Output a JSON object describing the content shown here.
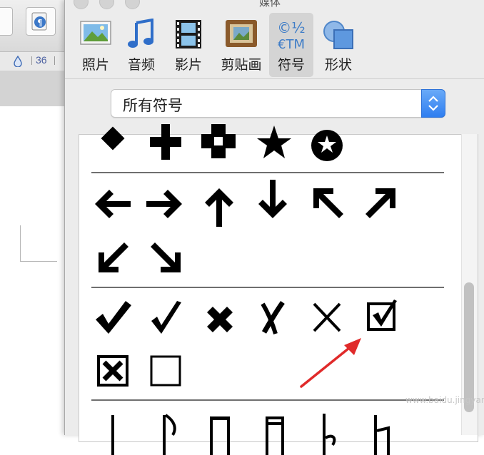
{
  "document_window": {
    "ruler_value": "36",
    "paragraph_icon": "paragraph-mark-icon",
    "drop_icon": "drop-icon"
  },
  "media_browser": {
    "title": "媒体",
    "tabs": [
      {
        "label": "照片",
        "icon": "photo-icon"
      },
      {
        "label": "音频",
        "icon": "music-note-icon"
      },
      {
        "label": "影片",
        "icon": "film-strip-icon"
      },
      {
        "label": "剪贴画",
        "icon": "clipart-frame-icon"
      },
      {
        "label": "符号",
        "icon": "symbols-icon",
        "icon_text_top": "©½",
        "icon_text_bottom": "€TM",
        "active": true
      },
      {
        "label": "形状",
        "icon": "shapes-icon"
      }
    ],
    "category_select": {
      "value": "所有符号"
    },
    "symbol_groups": [
      {
        "name": "shapes",
        "symbols": [
          "✖",
          "✚",
          "✜",
          "★",
          "✪"
        ]
      },
      {
        "name": "arrows",
        "symbols": [
          "←",
          "→",
          "↑",
          "↓",
          "↖",
          "↗",
          "↙",
          "↘"
        ]
      },
      {
        "name": "checks",
        "symbols": [
          "✔",
          "✓",
          "✖",
          "✗",
          "✕",
          "☑",
          "☒",
          "☐"
        ]
      },
      {
        "name": "music",
        "symbols": [
          "♩",
          "♪",
          "♫",
          "♬",
          "♭",
          "♮"
        ]
      }
    ],
    "watermark": "www.baidu.jingyan.com"
  },
  "colors": {
    "annotation_arrow": "#e02a2a",
    "stepper_blue": "#3b86f3",
    "accent_tab": "#d4d4d4"
  }
}
